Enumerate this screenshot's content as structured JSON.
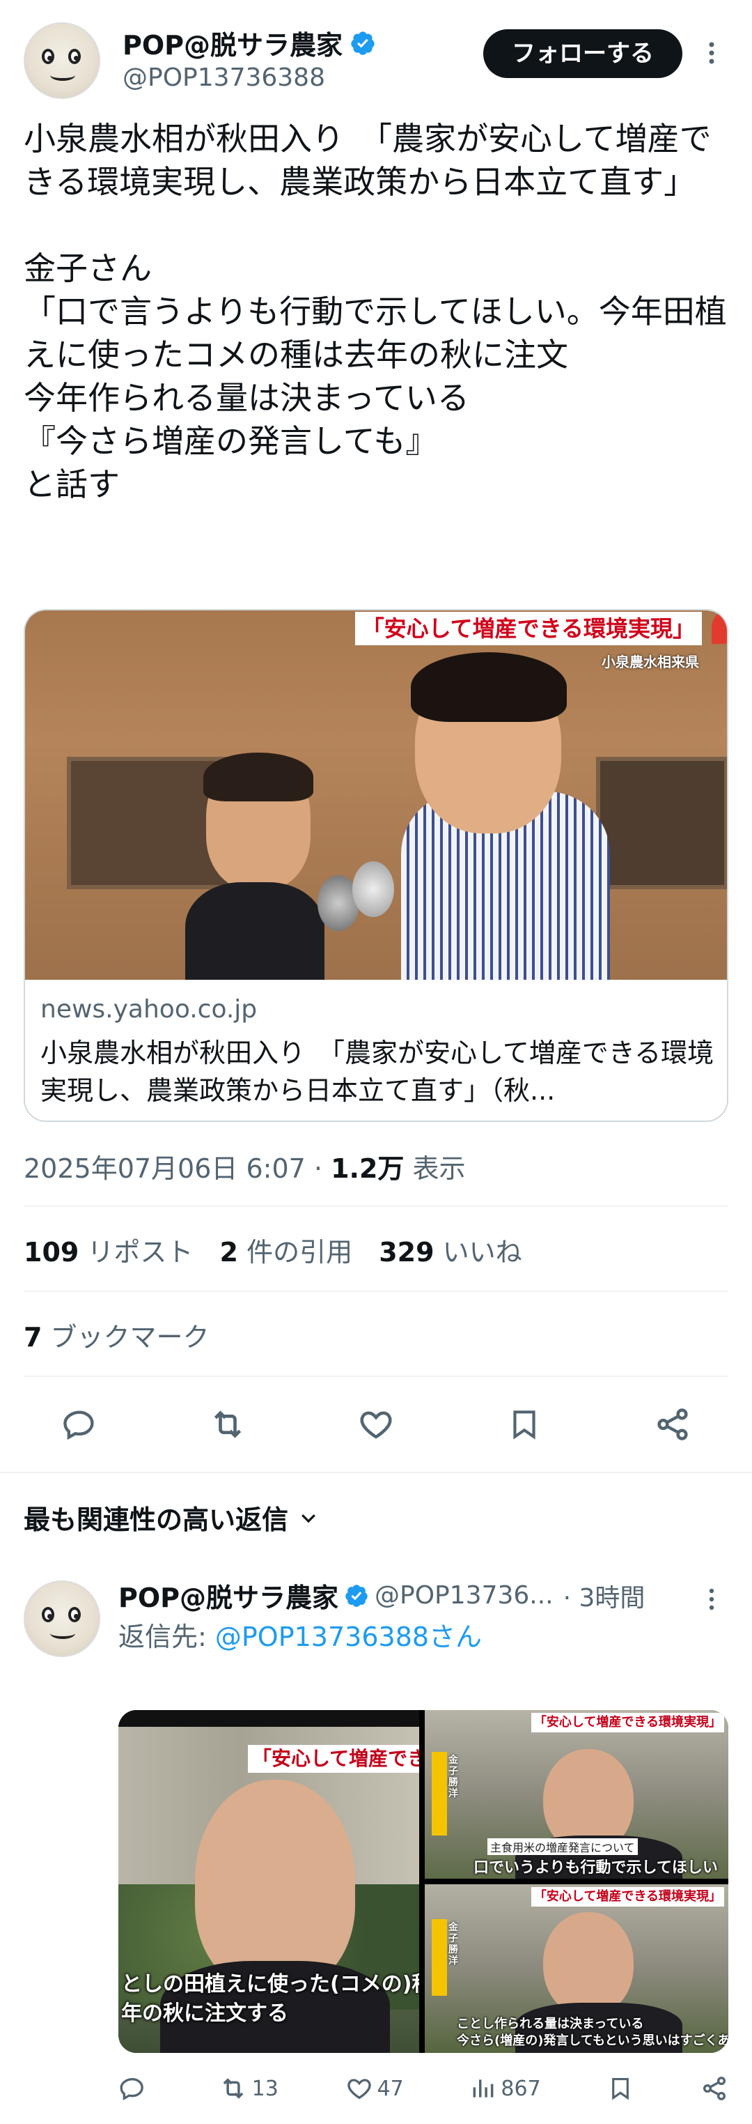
{
  "tweet": {
    "author_name": "POP@脱サラ農家",
    "author_handle": "@POP13736388",
    "follow_label": "フォローする",
    "more_icon": "more-vertical-icon",
    "text": "小泉農水相が秋田入り　「農家が安心して増産できる環境実現し、農業政策から日本立て直す」\n\n金子さん\n「口で言うよりも行動で示してほしい。今年田植えに使ったコメの種は去年の秋に注文\n今年作られる量は決まっている\n『今さら増産の発言しても』\nと話す",
    "card": {
      "image_caption": "「安心して増産できる環境実現」",
      "image_subcaption": "小泉農水相来県",
      "domain": "news.yahoo.co.jp",
      "title": "小泉農水相が秋田入り　「農家が安心して増産できる環境実現し、農業政策から日本立て直す」（秋..."
    },
    "timestamp": "2025年07月06日 6:07",
    "separator": "·",
    "views_count": "1.2万",
    "views_label": "表示",
    "stats": {
      "reposts_count": "109",
      "reposts_label": "リポスト",
      "quotes_count": "2",
      "quotes_label": "件の引用",
      "likes_count": "329",
      "likes_label": "いいね",
      "bookmarks_count": "7",
      "bookmarks_label": "ブックマーク"
    }
  },
  "replies_header": {
    "label": "最も関連性の高い返信"
  },
  "reply": {
    "author_name": "POP@脱サラ農家",
    "author_handle": "@POP13736...",
    "time": "· 3時間",
    "reply_to_prefix": "返信先: ",
    "reply_to_handle": "@POP13736388",
    "reply_to_suffix": "さん",
    "photos": {
      "left_caption_top": "「安心して増産できる",
      "left_subtitle_1": "としの田植えに使った(コメの)種",
      "left_subtitle_2": "年の秋に注文する",
      "tr_caption": "「安心して増産できる環境実現」",
      "tr_topic": "主食用米の増産発言について",
      "tr_subtitle": "口でいうよりも行動で示してほしい",
      "tr_name": "金子 勝洋",
      "br_caption": "「安心して増産できる環境実現」",
      "br_name": "金子 勝洋",
      "br_subtitle_1": "ことし作られる量は決まっている",
      "br_subtitle_2": "今さら(増産の)発言してもという思いはすごくある"
    },
    "actions": {
      "replies": "",
      "reposts": "13",
      "likes": "47",
      "views": "867"
    }
  },
  "colors": {
    "accent": "#1d9bf0",
    "text": "#0f1419",
    "secondary": "#536471",
    "border": "#cfd9de"
  }
}
